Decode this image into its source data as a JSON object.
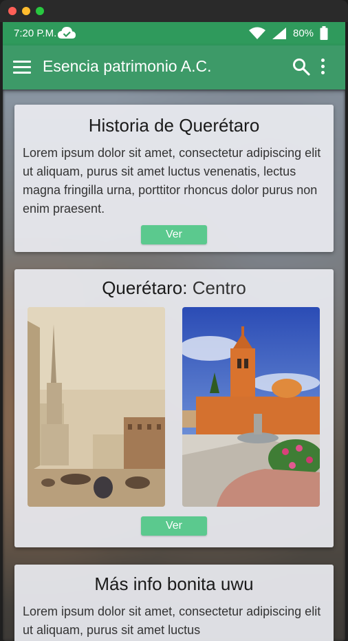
{
  "status_bar": {
    "time": "7:20 P.M.",
    "battery": "80%"
  },
  "app_bar": {
    "title": "Esencia patrimonio A.C."
  },
  "cards": [
    {
      "title": "Historia de Querétaro",
      "text": "Lorem ipsum dolor sit amet, consectetur adipiscing elit ut aliquam, purus sit amet luctus venenatis, lectus magna fringilla urna, porttitor rhoncus dolor purus non enim praesent.",
      "button": "Ver"
    },
    {
      "title_main": "Querétaro:",
      "title_sub": "Centro",
      "button": "Ver"
    },
    {
      "title": "Más info bonita uwu",
      "text": "Lorem ipsum dolor sit amet, consectetur adipiscing elit ut aliquam, purus sit amet luctus"
    }
  ],
  "colors": {
    "status_bar": "#2f9a5c",
    "app_bar": "#3d9a68",
    "button": "#5bc98e"
  }
}
